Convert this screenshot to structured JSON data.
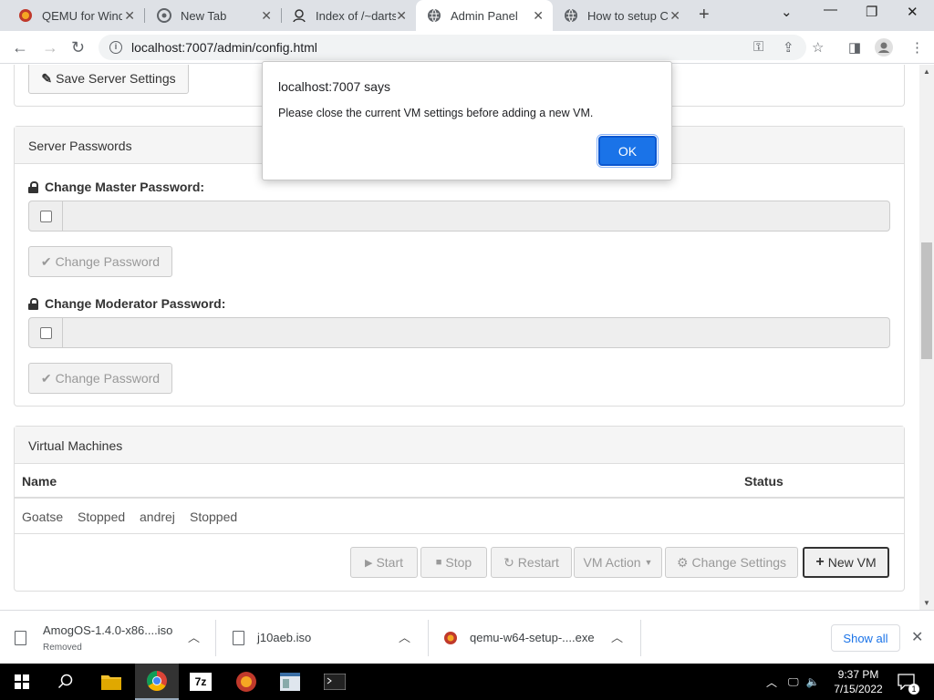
{
  "browser": {
    "tabs": [
      {
        "label": "QEMU for Wind",
        "icon": "qemu-icon",
        "active": false
      },
      {
        "label": "New Tab",
        "icon": "chrome-icon",
        "active": false
      },
      {
        "label": "Index of /~darts",
        "icon": "user-icon",
        "active": false
      },
      {
        "label": "Admin Panel",
        "icon": "globe-icon",
        "active": true
      },
      {
        "label": "How to setup C",
        "icon": "globe-icon",
        "active": false
      }
    ],
    "url": "localhost:7007/admin/config.html"
  },
  "page": {
    "save_settings_label": "Save Server Settings",
    "passwords_panel": {
      "title": "Server Passwords",
      "master_label": "Change Master Password:",
      "moderator_label": "Change Moderator Password:",
      "change_password_label": "Change Password"
    },
    "vm_panel": {
      "title": "Virtual Machines",
      "columns": [
        "Name",
        "Status"
      ],
      "rows": [
        {
          "name": "Goatse",
          "status": "Stopped"
        },
        {
          "name": "andrej",
          "status": "Stopped"
        }
      ],
      "buttons": {
        "start": "Start",
        "stop": "Stop",
        "restart": "Restart",
        "vm_action": "VM Action",
        "change_settings": "Change Settings",
        "new_vm": "New VM"
      }
    }
  },
  "dialog": {
    "title": "localhost:7007 says",
    "message": "Please close the current VM settings before adding a new VM.",
    "ok": "OK"
  },
  "downloads": {
    "items": [
      {
        "name": "AmogOS-1.4.0-x86....iso",
        "status": "Removed"
      },
      {
        "name": "j10aeb.iso",
        "status": ""
      },
      {
        "name": "qemu-w64-setup-....exe",
        "status": ""
      }
    ],
    "show_all": "Show all"
  },
  "taskbar": {
    "time": "9:37 PM",
    "date": "7/15/2022",
    "notification_count": "1"
  }
}
